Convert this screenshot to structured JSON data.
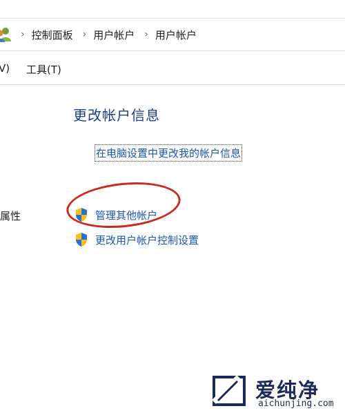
{
  "breadcrumb": {
    "sep": "›",
    "items": [
      "控制面板",
      "用户帐户",
      "用户帐户"
    ]
  },
  "menubar": {
    "view_label": "V)",
    "tools_label": "工具(T)"
  },
  "main": {
    "title": "更改帐户信息",
    "change_info_link": "在电脑设置中更改我的帐户信息",
    "left_props_label": "属性",
    "tasks": [
      {
        "label": "管理其他帐户",
        "icon": "uac-shield-icon"
      },
      {
        "label": "更改用户帐户控制设置",
        "icon": "uac-shield-icon"
      }
    ]
  },
  "watermark": {
    "title": "爱纯净",
    "url": "aichunjing.com"
  },
  "colors": {
    "link": "#1a56b8",
    "title": "#1f3c88",
    "annotation_ellipse": "#cd2a1f",
    "watermark": "#1b2a5a"
  }
}
